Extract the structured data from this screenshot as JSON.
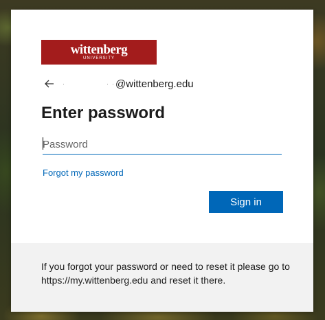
{
  "logo": {
    "wordmark": "wittenberg",
    "subtitle": "UNIVERSITY",
    "brand_color": "#a31c1c"
  },
  "identity": {
    "back_icon": "arrow-left-icon",
    "email_domain": "@wittenberg.edu"
  },
  "heading": "Enter password",
  "password_field": {
    "placeholder": "Password",
    "value": ""
  },
  "forgot_link": "Forgot my password",
  "signin_button": "Sign in",
  "footer": {
    "message": "If you forgot your password or need to reset it please go to https://my.wittenberg.edu and reset it there."
  },
  "colors": {
    "accent": "#0067b8",
    "footer_bg": "#f2f2f2"
  }
}
